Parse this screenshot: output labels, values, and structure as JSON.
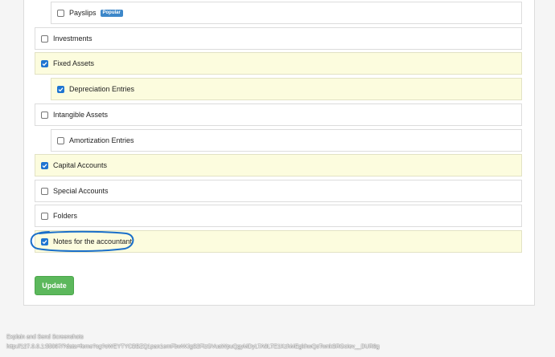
{
  "items": [
    {
      "label": "Payslips",
      "checked": false,
      "badge": "Popular"
    },
    {
      "label": "Investments",
      "checked": false
    },
    {
      "label": "Fixed Assets",
      "checked": true
    },
    {
      "label": "Depreciation Entries",
      "checked": true
    },
    {
      "label": "Intangible Assets",
      "checked": false
    },
    {
      "label": "Amortization Entries",
      "checked": false
    },
    {
      "label": "Capital Accounts",
      "checked": true
    },
    {
      "label": "Special Accounts",
      "checked": false
    },
    {
      "label": "Folders",
      "checked": false
    },
    {
      "label": "Notes for the accountant",
      "checked": true
    }
  ],
  "update_label": "Update",
  "annotation_color": "#1a6fc9",
  "status": {
    "line1": "Explain and Send Screenshots",
    "line2": "http://127.0.0.1:55087/?data=feme?cg?oWEYTYCBBZQ1pan1emFbwWJgS2FizGVuaWpuQgyMDyLTA8LTE1KzhMEgkhwQsTwnkSRGcIev__DUR8g"
  }
}
